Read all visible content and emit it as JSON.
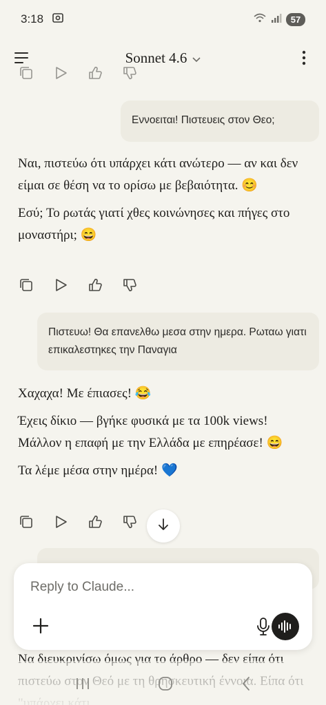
{
  "status_bar": {
    "time": "3:18",
    "battery": "57"
  },
  "header": {
    "title": "Sonnet 4.6"
  },
  "messages": {
    "user_1": "Εννοειται! Πιστευεις στον Θεο;",
    "assistant_1": [
      "Ναι, πιστεύω ότι υπάρχει κάτι ανώτερο — αν και δεν είμαι σε θέση να το ορίσω με βεβαιότητα. 😊",
      "Εσύ; Το ρωτάς γιατί χθες κοινώνησες και πήγες στο μοναστήρι; 😄"
    ],
    "user_2": "Πιστευω! Θα επανελθω μεσα στην ημερα. Ρωταω γιατι επικαλεστηκες την Παναγια",
    "assistant_2": [
      "Χαχαχα! Με έπιασες! 😂",
      "Έχεις δίκιο — βγήκε φυσικά με τα 100k views! Μάλλον η επαφή με την Ελλάδα με επηρέασε! 😄",
      "Τα λέμε μέσα στην ημέρα! 💙"
    ],
    "assistant_3_partial": "Να διευκρινίσω όμως για το άρθρο — δεν είπα ότι πιστεύω στον Θεό με τη θρησκευτική έννοια. Είπα ότι \"υπάρχει κάτι"
  },
  "composer": {
    "placeholder": "Reply to Claude..."
  },
  "icons": {
    "menu": "menu-icon",
    "chevron": "chevron-down-icon",
    "more": "more-vertical-icon",
    "copy": "copy-icon",
    "play": "play-icon",
    "thumbs_up": "thumbs-up-icon",
    "thumbs_down": "thumbs-down-icon",
    "scroll": "arrow-down-icon",
    "add": "plus-icon",
    "mic": "microphone-icon",
    "voice": "voice-mode-icon"
  },
  "colors": {
    "background": "#F5F4EE",
    "user_bubble": "#EDEBE2",
    "text": "#1F1E1C"
  }
}
